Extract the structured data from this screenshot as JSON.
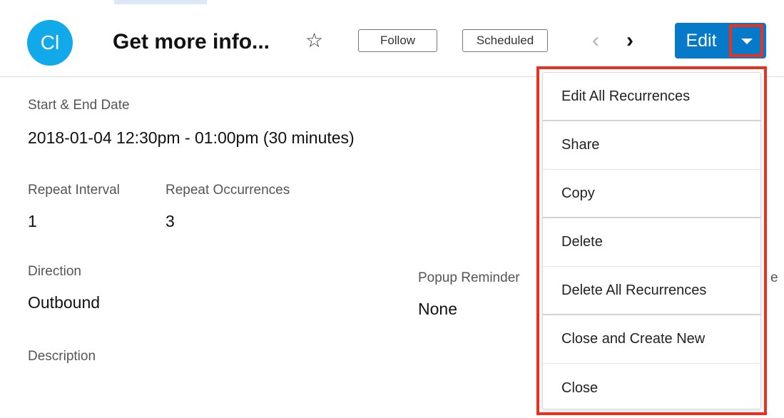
{
  "record": {
    "avatar_initials": "Cl",
    "title": "Get more info...",
    "star_glyph": "☆",
    "follow_label": "Follow",
    "status_label": "Scheduled",
    "prev_glyph": "‹",
    "next_glyph": "›",
    "edit_label": "Edit"
  },
  "fields": {
    "start_end_label": "Start & End Date",
    "start_end_value": "2018-01-04 12:30pm - 01:00pm (30 minutes)",
    "repeat_interval_label": "Repeat Interval",
    "repeat_interval_value": "1",
    "repeat_occurrences_label": "Repeat Occurrences",
    "repeat_occurrences_value": "3",
    "direction_label": "Direction",
    "direction_value": "Outbound",
    "popup_reminder_label": "Popup Reminder",
    "popup_reminder_value": "None",
    "description_label": "Description",
    "truncated_right_label": "e"
  },
  "dropdown": {
    "items": [
      {
        "label": "Edit All Recurrences"
      },
      {
        "label": "Share"
      },
      {
        "label": "Copy"
      },
      {
        "label": "Delete"
      },
      {
        "label": "Delete All Recurrences"
      },
      {
        "label": "Close and Create New"
      },
      {
        "label": "Close"
      }
    ]
  },
  "colors": {
    "accent": "#0679c8",
    "avatar": "#11a9ea",
    "highlight": "#e8321f"
  },
  "icons": {
    "star": "star-icon",
    "prev": "chevron-left-icon",
    "next": "chevron-right-icon",
    "caret": "caret-down-icon"
  }
}
